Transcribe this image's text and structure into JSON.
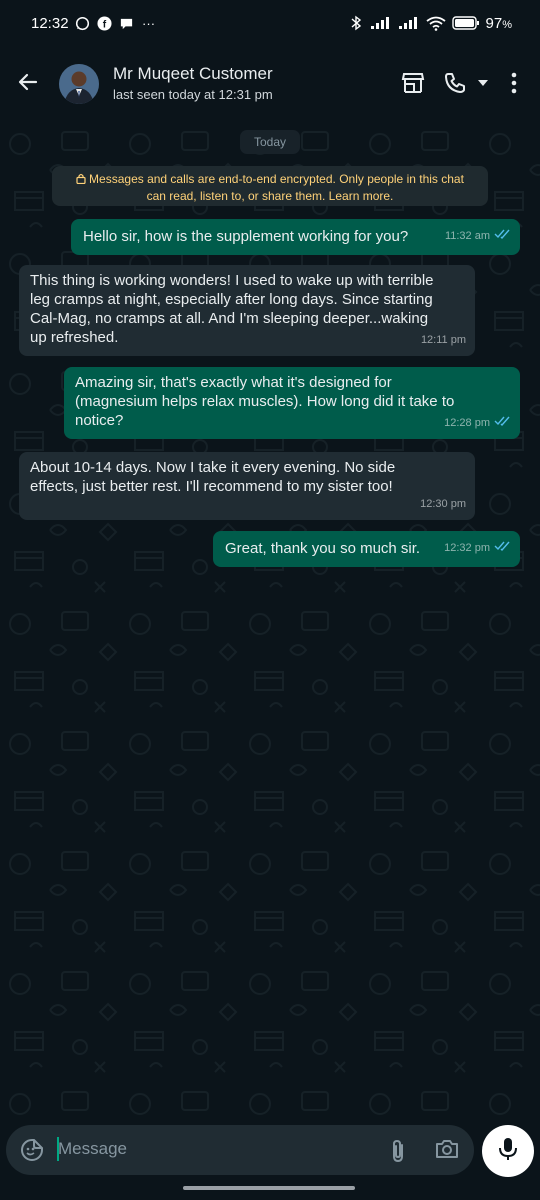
{
  "status_bar": {
    "time": "12:32",
    "battery": "97",
    "battery_unit": "%",
    "notification_icons": [
      "whatsapp-icon",
      "facebook-icon",
      "chat-icon",
      "more-dots"
    ]
  },
  "header": {
    "contact_name": "Mr Muqeet Customer",
    "last_seen": "last seen today at 12:31 pm"
  },
  "chat": {
    "date_chip": "Today",
    "encryption_notice_line1": "Messages and calls are end-to-end encrypted. Only people in this chat",
    "encryption_notice_line2": "can read, listen to, or share them. Learn more.",
    "messages": [
      {
        "dir": "out",
        "lines": [
          "Hello sir, how is the supplement working for you?"
        ],
        "time": "11:32 am",
        "read": true
      },
      {
        "dir": "in",
        "lines": [
          "This thing is working wonders! I used to wake up with terrible",
          "leg cramps at night, especially after long days. Since starting",
          "Cal-Mag, no cramps at all. And I'm sleeping deeper...waking",
          "up refreshed."
        ],
        "time": "12:11 pm"
      },
      {
        "dir": "out",
        "lines": [
          "Amazing sir, that's exactly what it's designed for",
          "(magnesium helps relax muscles). How long did it take to",
          "notice?"
        ],
        "time": "12:28 pm",
        "read": true
      },
      {
        "dir": "in",
        "lines": [
          "About 10-14 days. Now I take it every evening. No side",
          "effects, just better rest. I'll recommend to my sister too!"
        ],
        "time": "12:30 pm"
      },
      {
        "dir": "out",
        "lines": [
          "Great, thank you so much sir."
        ],
        "time": "12:32 pm",
        "read": true
      }
    ]
  },
  "composer": {
    "placeholder": "Message"
  },
  "colors": {
    "background": "#0b141a",
    "outgoing_bubble": "#005c4b",
    "incoming_bubble": "#202c33",
    "read_tick": "#53bdeb",
    "encryption_text": "#ffd279"
  }
}
